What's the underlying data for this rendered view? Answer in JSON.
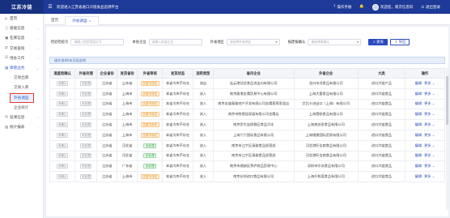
{
  "header": {
    "brand": "江苏冷链",
    "welcome": "欢迎进入江苏省进口冷链食品追溯平台",
    "manual": "操作手册",
    "user": "欢迎您，南京信息科",
    "logout": "退出登录",
    "menu_icon": "hamburger-icon"
  },
  "sidebar": {
    "items": [
      {
        "label": "首页",
        "icon": "home-icon"
      },
      {
        "label": "基础信息",
        "icon": "info-icon"
      },
      {
        "label": "在库信息",
        "icon": "box-icon"
      },
      {
        "label": "交易查询",
        "icon": "swap-icon"
      },
      {
        "label": "待办工作",
        "icon": "task-icon"
      },
      {
        "label": "库管业务",
        "icon": "warehouse-icon"
      }
    ],
    "subitems": [
      "交易出库",
      "交易入库",
      "外省调运",
      "企业统计"
    ],
    "bottom_items": [
      {
        "label": "追溯信息",
        "icon": "trace-icon"
      },
      {
        "label": "统计报表",
        "icon": "chart-icon"
      }
    ]
  },
  "tabs": [
    {
      "label": "首页"
    },
    {
      "label": "外省调运",
      "close": "×"
    }
  ],
  "filters": {
    "goods_label": "检验检疫号",
    "goods_placeholder": "请输入检验检疫证号",
    "company_label": "本省企业",
    "company_placeholder": "请输入本省企业",
    "province_label": "外省地区",
    "province_placeholder": "请选择外省地区",
    "reject_label": "报废报确认",
    "reject_placeholder": "请选择报确认",
    "search": "查询",
    "export": "导出"
  },
  "notice": "操作说明/本页面说明",
  "table": {
    "columns": [
      "温度检确认",
      "外省处理",
      "企业省份",
      "发货省份",
      "外省审核",
      "发货状态",
      "流转类型",
      "省内企业",
      "外省企业",
      "大类",
      "操作"
    ],
    "rows": [
      [
        "未确认",
        "未处理",
        "江苏省",
        "山东省",
        "交易不存在",
        "本省冷库不存在",
        "流出",
        "连云港佳信食品进出口有限公司",
        "龙口市洋食品有限公司",
        "进口冷链产品"
      ],
      [
        "未确认",
        "未处理",
        "江苏省",
        "上海市",
        "交易不存在",
        "本省冷库不存在",
        "流入",
        "南京路港金鹰贸易中心有限公司",
        "上海大要食品有限公司",
        "进口冷链食品"
      ],
      [
        "未确认",
        "未处理",
        "江苏省",
        "上海市",
        "交易不存在",
        "本省冷库不存在",
        "流入",
        "南京金盛泰路地产开发有限公司金鹰奥莱家居店",
        "艾比卡进出口（上海）有限公司",
        "进口冷链食品"
      ],
      [
        "未确认",
        "未处理",
        "江苏省",
        "上海市",
        "交易不存在",
        "本省冷库不存在",
        "流入",
        "南京市鲜食园发展有限公司金鹰店",
        "上海雪联食品有限公司",
        "进口冷链食品"
      ],
      [
        "未确认",
        "未处理",
        "江苏省",
        "上海市",
        "交易不存在",
        "本省冷库不存在",
        "流入",
        "南京伊大连保税区食品冷冻",
        "上海南创多食品有限公司",
        "进口冷链食品"
      ],
      [
        "未确认",
        "未处理",
        "江苏省",
        "上海市",
        "交易不存在",
        "本省冷库不存在",
        "流入",
        "上海六六国际食品有限公司",
        "上海储捷国际贸易有限公司",
        "进口冷链食品"
      ],
      [
        "未确认",
        "未处理",
        "江苏省",
        "河北省",
        "未处理",
        "本省冷库不存在",
        "流入",
        "南京市江宁区清雅食品经营部",
        "河北港旺佳商食品有限公司",
        "进口冷链食品"
      ],
      [
        "未确认",
        "未处理",
        "江苏省",
        "河北省",
        "未处理",
        "本省冷库不存在",
        "流入",
        "南京市江宁区清雅食品经营部",
        "河北港旺佳商食品有限公司",
        "进口冷链食品"
      ],
      [
        "未确认",
        "未处理",
        "江苏省",
        "广东省",
        "未处理",
        "本省冷库不存在",
        "流入",
        "南京市建邺区茅庐商品贸易中心",
        "深圳市尔苏食品有限公司",
        "进口冷链食品"
      ],
      [
        "未确认",
        "未处理",
        "江苏省",
        "上海市",
        "交易不存在",
        "本省冷库不存在",
        "流入",
        "南京长圳进口食品有限公司",
        "上海仟和菜食品有限公司",
        "进口冷链食品"
      ]
    ],
    "edit": "编辑",
    "more": "更多"
  },
  "colors": {
    "header_bg": "#1e3a98",
    "brand_bg": "#173080",
    "primary": "#2a4bbf",
    "orange_tag": "#e08a1a",
    "green_tag": "#3aa94a",
    "highlight": "#e53935"
  }
}
